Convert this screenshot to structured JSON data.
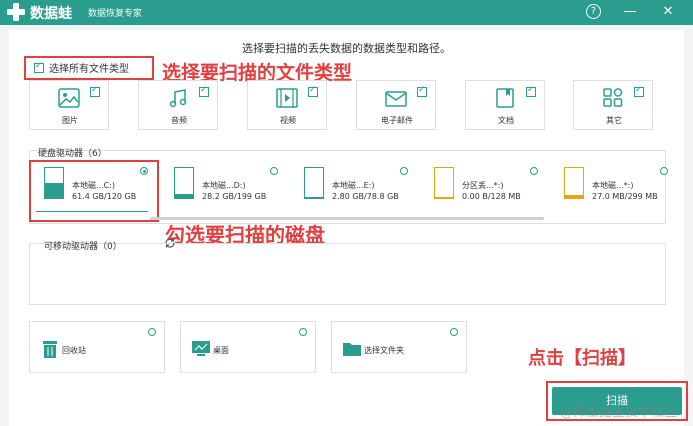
{
  "titlebar": {
    "app_name": "数据蛙",
    "subtitle": "数据恢复专家",
    "help": "?",
    "minimize": "—",
    "close": "✕"
  },
  "instruction": "选择要扫描的丢失数据的数据类型和路径。",
  "select_all": {
    "label": "选择所有文件类型",
    "checked": true
  },
  "annotations": {
    "file_type": "选择要扫描的文件类型",
    "disk": "勾选要扫描的磁盘",
    "scan": "点击【扫描】"
  },
  "file_types": [
    {
      "label": "图片",
      "icon": "image-icon",
      "checked": true
    },
    {
      "label": "音频",
      "icon": "music-icon",
      "checked": true
    },
    {
      "label": "视频",
      "icon": "video-icon",
      "checked": true
    },
    {
      "label": "电子邮件",
      "icon": "mail-icon",
      "checked": true
    },
    {
      "label": "文档",
      "icon": "document-icon",
      "checked": true
    },
    {
      "label": "其它",
      "icon": "other-icon",
      "checked": true
    }
  ],
  "hard_drives": {
    "title": "硬盘驱动器（6）",
    "items": [
      {
        "name": "本地磁...C:)",
        "size": "61.4 GB/120 GB",
        "selected": true,
        "fill": 0.51,
        "color": "#2a9d8f"
      },
      {
        "name": "本地磁...D:)",
        "size": "28.2 GB/199 GB",
        "selected": false,
        "fill": 0.14,
        "color": "#2a9d8f"
      },
      {
        "name": "本地磁...E:)",
        "size": "2.80 GB/78.8 GB",
        "selected": false,
        "fill": 0.04,
        "color": "#2a9d8f"
      },
      {
        "name": "分区丢...*:)",
        "size": "0.00  B/128 MB",
        "selected": false,
        "fill": 0.0,
        "color": "#e8a317"
      },
      {
        "name": "本地磁...*:)",
        "size": "27.0 MB/299 MB",
        "selected": false,
        "fill": 0.09,
        "color": "#e8a317"
      }
    ]
  },
  "removable": {
    "title": "可移动驱动器（0）",
    "refresh_icon": "refresh-icon"
  },
  "locations": [
    {
      "label": "回收站",
      "icon": "recycle-bin-icon"
    },
    {
      "label": "桌面",
      "icon": "desktop-icon"
    },
    {
      "label": "选择文件夹",
      "icon": "folder-icon"
    }
  ],
  "scan_button": "扫描",
  "watermark": "@稀土掘金技术社区"
}
